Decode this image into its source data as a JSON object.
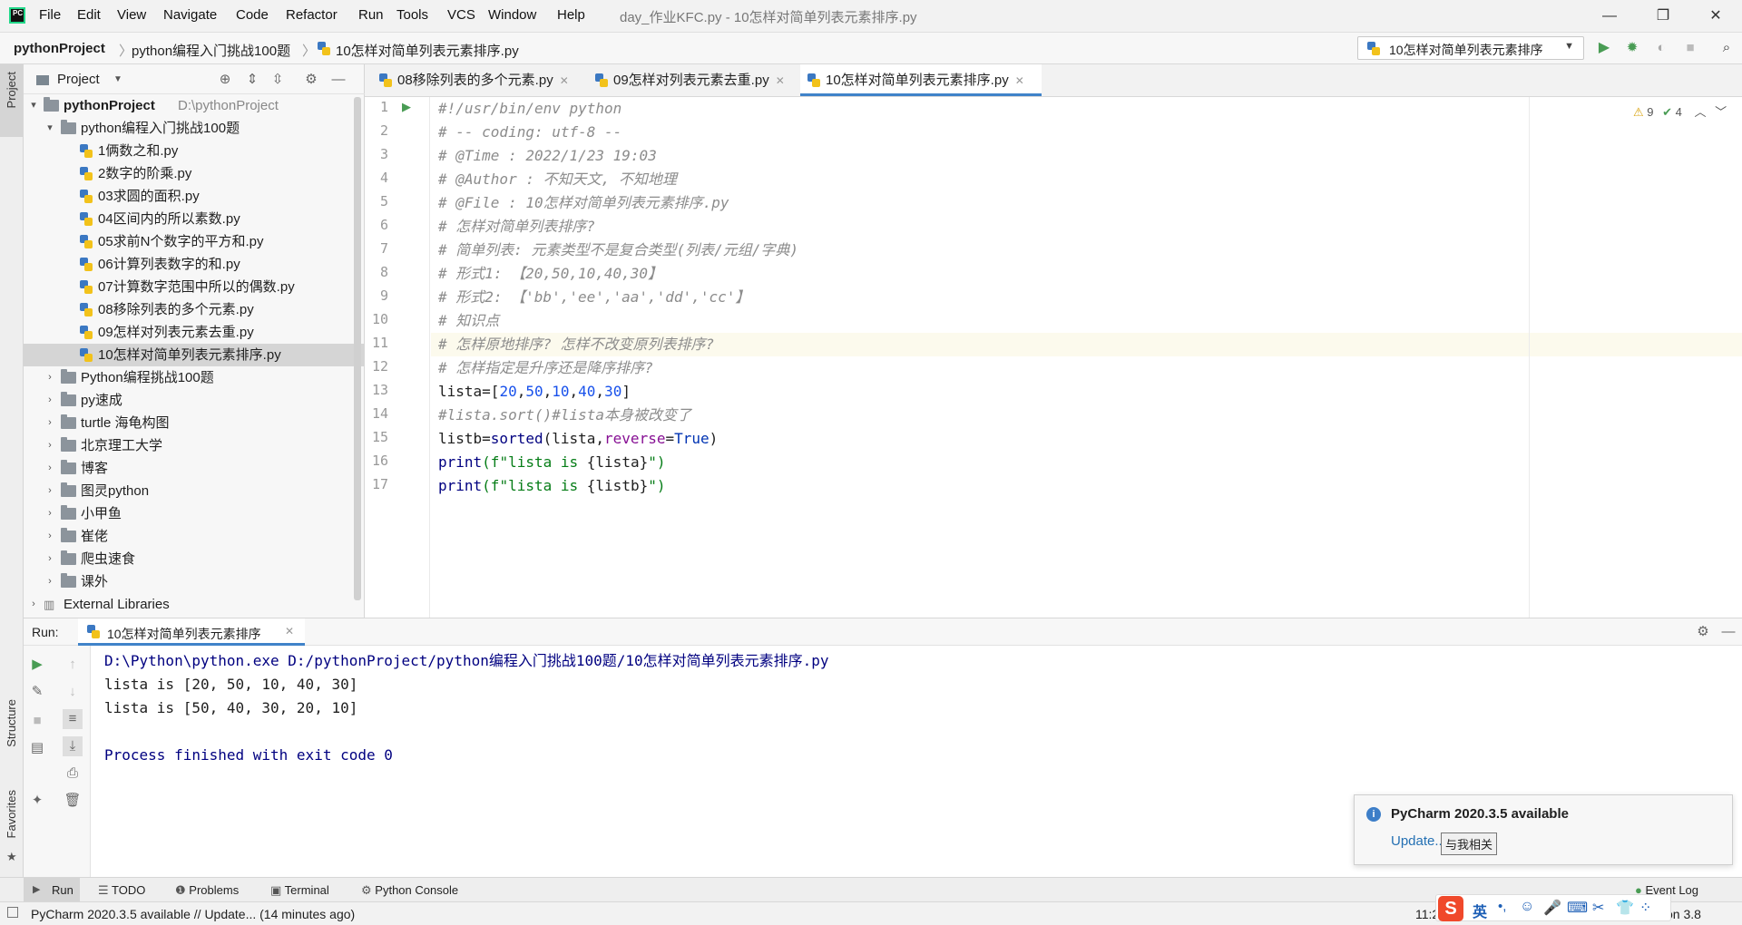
{
  "window": {
    "title": "day_作业KFC.py - 10怎样对简单列表元素排序.py",
    "controls": {
      "minimize": "—",
      "maximize": "❐",
      "close": "✕"
    }
  },
  "menu": [
    "File",
    "Edit",
    "View",
    "Navigate",
    "Code",
    "Refactor",
    "Run",
    "Tools",
    "VCS",
    "Window",
    "Help"
  ],
  "breadcrumb": {
    "project": "pythonProject",
    "folder": "python编程入门挑战100题",
    "file": "10怎样对简单列表元素排序.py"
  },
  "run_config": {
    "label": "10怎样对简单列表元素排序"
  },
  "side_labels": {
    "project": "Project",
    "structure": "Structure",
    "favorites": "Favorites"
  },
  "project_panel": {
    "header": "Project",
    "root": {
      "name": "pythonProject",
      "path": "D:\\pythonProject"
    },
    "open_folder": "python编程入门挑战100题",
    "files": [
      "1俩数之和.py",
      "2数字的阶乘.py",
      "03求圆的面积.py",
      "04区间内的所以素数.py",
      "05求前N个数字的平方和.py",
      "06计算列表数字的和.py",
      "07计算数字范围中所以的偶数.py",
      "08移除列表的多个元素.py",
      "09怎样对列表元素去重.py",
      "10怎样对简单列表元素排序.py"
    ],
    "folders": [
      "Python编程挑战100题",
      "py速成",
      "turtle 海龟构图",
      "北京理工大学",
      "博客",
      "图灵python",
      "小甲鱼",
      "崔佬",
      "爬虫速食",
      "课外"
    ],
    "external": "External Libraries"
  },
  "editor": {
    "tabs": [
      {
        "label": "08移除列表的多个元素.py",
        "close": "✕"
      },
      {
        "label": "09怎样对列表元素去重.py",
        "close": "✕"
      },
      {
        "label": "10怎样对简单列表元素排序.py",
        "close": "✕"
      }
    ],
    "inspections": {
      "warnings": "9",
      "typos": "4"
    },
    "line_numbers": [
      "1",
      "2",
      "3",
      "4",
      "5",
      "6",
      "7",
      "8",
      "9",
      "10",
      "11",
      "12",
      "13",
      "14",
      "15",
      "16",
      "17"
    ],
    "lines": {
      "l1": "#!/usr/bin/env python",
      "l2": "# -- coding: utf-8 --",
      "l3": "# @Time : 2022/1/23 19:03",
      "l4": "# @Author : 不知天文, 不知地理",
      "l5": "# @File : 10怎样对简单列表元素排序.py",
      "l6": "# 怎样对简单列表排序?",
      "l7": "# 简单列表: 元素类型不是复合类型(列表/元组/字典)",
      "l8": "# 形式1: 【20,50,10,40,30】",
      "l9": "# 形式2: 【'bb','ee','aa','dd','cc'】",
      "l10": "# 知识点",
      "l11": "# 怎样原地排序? 怎样不改变原列表排序?",
      "l12": "# 怎样指定是升序还是降序排序?",
      "l13": {
        "a": "lista=[",
        "n1": "20",
        "c1": ",",
        "n2": "50",
        "c2": ",",
        "n3": "10",
        "c3": ",",
        "n4": "40",
        "c4": ",",
        "n5": "30",
        "b": "]"
      },
      "l14": "#lista.sort()#lista本身被改变了",
      "l15": {
        "a": "listb=",
        "fn": "sorted",
        "b": "(lista,",
        "p": "reverse",
        "eq": "=",
        "kw": "True",
        "c": ")"
      },
      "l16": {
        "fn": "print",
        "a": "(f\"",
        "s": "lista is ",
        "b": "{lista}",
        "e": "\")"
      },
      "l17": {
        "fn": "print",
        "a": "(f\"",
        "s": "lista is ",
        "b": "{listb}",
        "e": "\")"
      }
    }
  },
  "run": {
    "label": "Run:",
    "tab": "10怎样对简单列表元素排序",
    "output": [
      "D:\\Python\\python.exe D:/pythonProject/python编程入门挑战100题/10怎样对简单列表元素排序.py",
      "lista is [20, 50, 10, 40, 30]",
      "lista is [50, 40, 30, 20, 10]",
      "",
      "Process finished with exit code 0"
    ]
  },
  "bottom_tools": [
    "Run",
    "TODO",
    "Problems",
    "Terminal",
    "Python Console"
  ],
  "event_log": "Event Log",
  "notification": {
    "title": "PyCharm 2020.3.5 available",
    "link": "Update...",
    "tooltip": "与我相关"
  },
  "status": {
    "message": "PyCharm 2020.3.5 available // Update... (14 minutes ago)",
    "time_partial": "11:2",
    "interpreter_partial": "on 3.8",
    "ime": "英"
  },
  "colors": {
    "accent": "#4083c9",
    "run_green": "#499c54",
    "comment": "#8c8c8c",
    "number": "#1750eb",
    "keyword": "#0033b3"
  }
}
